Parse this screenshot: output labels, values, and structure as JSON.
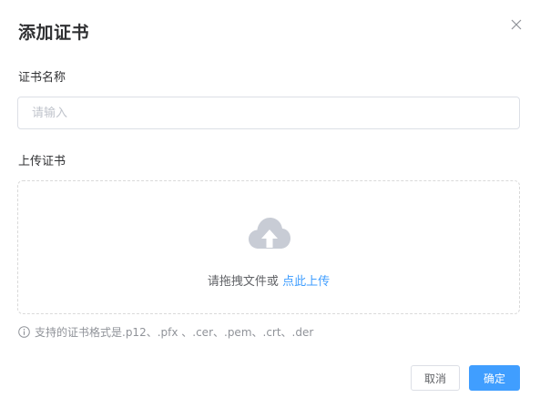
{
  "dialog": {
    "title": "添加证书",
    "close_icon": "close-icon"
  },
  "form": {
    "name_label": "证书名称",
    "name_placeholder": "请输入",
    "name_value": "",
    "upload_label": "上传证书",
    "upload_icon": "cloud-upload-icon",
    "drop_text": "请拖拽文件或 ",
    "drop_link": "点此上传",
    "hint_icon": "info-icon",
    "hint_text": "支持的证书格式是.p12、.pfx 、.cer、.pem、.crt、.der"
  },
  "footer": {
    "cancel_label": "取消",
    "ok_label": "确定"
  },
  "colors": {
    "primary": "#409eff",
    "icon_gray": "#c0c4cc",
    "border": "#dcdfe6"
  }
}
